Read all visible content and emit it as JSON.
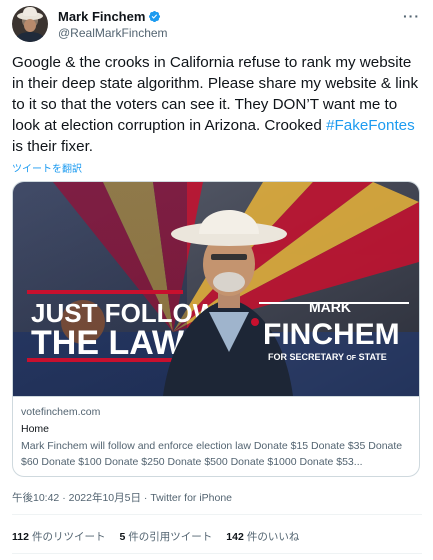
{
  "author": {
    "display_name": "Mark Finchem",
    "handle": "@RealMarkFinchem"
  },
  "menu": {
    "more_label": "···"
  },
  "tweet": {
    "text_part1": "Google & the crooks in California refuse to rank my website in their deep state algorithm. Please share my website & link to it so that the voters can see it. They DON’T want me to look at election corruption in Arizona. Crooked ",
    "hashtag": "#FakeFontes",
    "text_part2": " is their fixer.",
    "translate_label": "ツイートを翻訳"
  },
  "card": {
    "banner_left_line1": "JUST FOLLOW",
    "banner_left_line2": "THE LAW",
    "banner_right_line1": "MARK",
    "banner_right_line2": "FINCHEM",
    "banner_right_line3_a": "FOR SECRETARY",
    "banner_right_line3_b": "OF",
    "banner_right_line3_c": "STATE",
    "domain": "votefinchem.com",
    "title": "Home",
    "description": "Mark Finchem will follow and enforce election law Donate $15 Donate $35 Donate $60 Donate $100 Donate $250 Donate $500 Donate $1000 Donate $53..."
  },
  "timestamp": "午後10:42 · 2022年10月5日 · Twitter for iPhone",
  "stats": [
    {
      "count": "112",
      "label": "件のリツイート"
    },
    {
      "count": "5",
      "label": "件の引用ツイート"
    },
    {
      "count": "142",
      "label": "件のいいね"
    }
  ],
  "colors": {
    "link": "#1d9bf0",
    "banner_navy": "#0e1e4a",
    "banner_red": "#c8102e",
    "flag_copper": "#b5652a",
    "flag_yellow": "#e8b33a"
  }
}
